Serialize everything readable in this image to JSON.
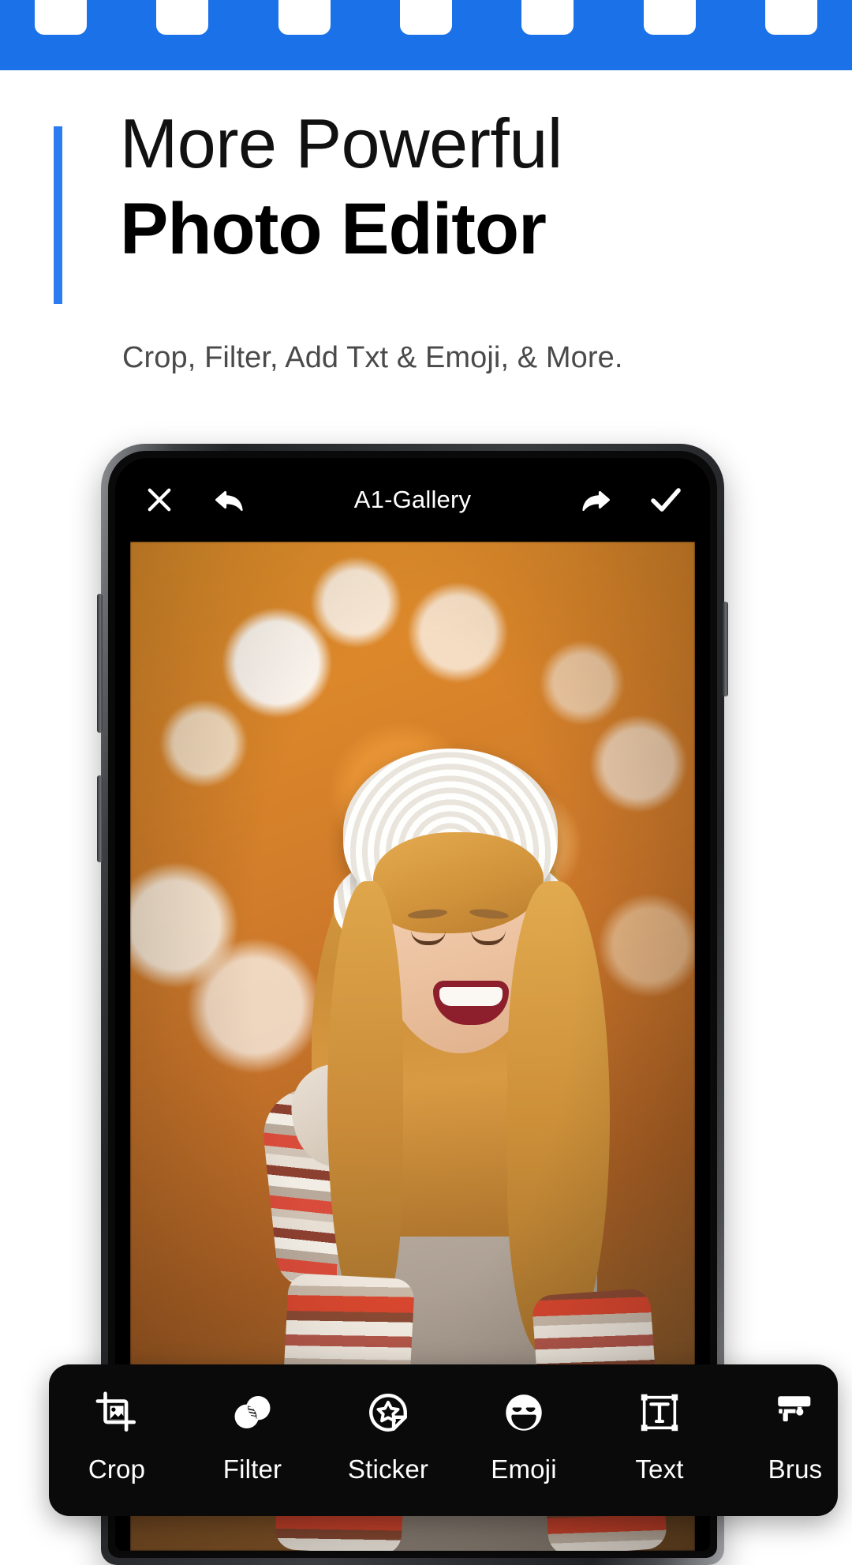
{
  "banner": {
    "color": "#1b72e8",
    "perforation_count": 7,
    "perforation_color": "#ffffff"
  },
  "headline": {
    "accent_color": "#2b7cf0",
    "line1": "More Powerful",
    "line2": "Photo Editor",
    "subtitle": "Crop, Filter, Add Txt & Emoji, & More."
  },
  "phone": {
    "app": {
      "header": {
        "close_icon": "close-x-icon",
        "undo_icon": "undo-arrow-icon",
        "title": "A1-Gallery",
        "redo_icon": "redo-arrow-icon",
        "confirm_icon": "checkmark-icon"
      },
      "photo": {
        "description": "Smiling blonde woman wearing a white knit hat and striped red and cream scarf, autumn orange bokeh background"
      },
      "toolbar": {
        "background": "#0a0a0a",
        "items": [
          {
            "label": "Crop",
            "icon": "crop-icon"
          },
          {
            "label": "Filter",
            "icon": "filter-circles-icon"
          },
          {
            "label": "Sticker",
            "icon": "sticker-star-icon"
          },
          {
            "label": "Emoji",
            "icon": "emoji-smile-icon"
          },
          {
            "label": "Text",
            "icon": "text-box-icon"
          },
          {
            "label": "Brus",
            "icon": "brush-roller-icon"
          }
        ]
      }
    }
  }
}
